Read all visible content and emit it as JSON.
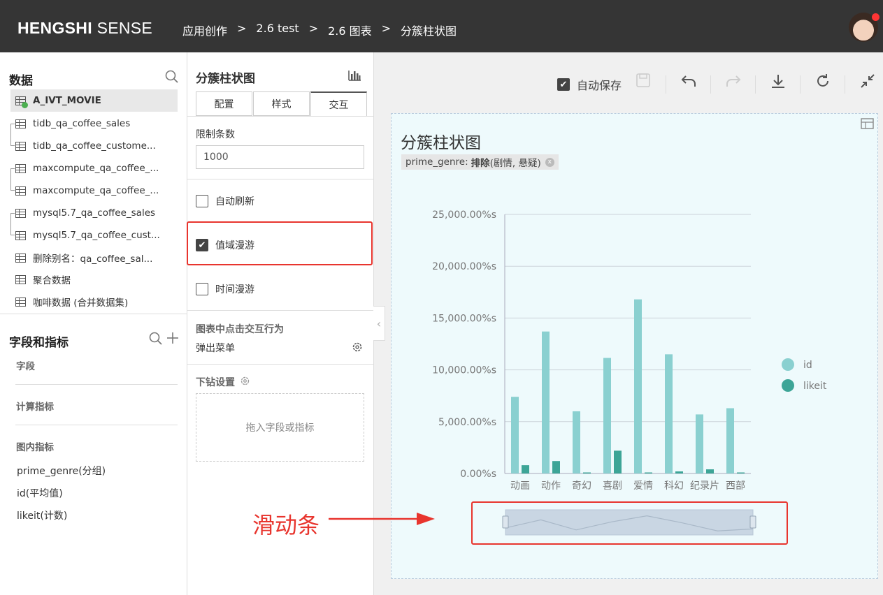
{
  "header": {
    "logo_bold": "HENGSHI",
    "logo_rest": " SENSE",
    "breadcrumbs": [
      "应用创作",
      "2.6 test",
      "2.6 图表",
      "分簇柱状图"
    ],
    "sep": ">"
  },
  "data_panel": {
    "title": "数据",
    "datasets": [
      {
        "label": "A_IVT_MOVIE",
        "active": true
      },
      {
        "label": "tidb_qa_coffee_sales"
      },
      {
        "label": "tidb_qa_coffee_custome..."
      },
      {
        "label": "maxcompute_qa_coffee_..."
      },
      {
        "label": "maxcompute_qa_coffee_..."
      },
      {
        "label": "mysql5.7_qa_coffee_sales"
      },
      {
        "label": "mysql5.7_qa_coffee_cust..."
      },
      {
        "label": "删除别名：qa_coffee_sal..."
      },
      {
        "label": "聚合数据"
      },
      {
        "label": "咖啡数据 (合并数据集)"
      }
    ]
  },
  "fields_panel": {
    "title": "字段和指标",
    "fields_head": "字段",
    "calc_head": "计算指标",
    "inchart_head": "图内指标",
    "inchart_items": [
      "prime_genre(分组)",
      "id(平均值)",
      "likeit(计数)"
    ]
  },
  "config_panel": {
    "title": "分簇柱状图",
    "tabs": [
      "配置",
      "样式",
      "交互"
    ],
    "active_tab": 2,
    "limit_label": "限制条数",
    "limit_value": "1000",
    "auto_refresh": "自动刷新",
    "range_roam": "值域漫游",
    "time_roam": "时间漫游",
    "click_action_label": "图表中点击交互行为",
    "click_action_value": "弹出菜单",
    "drill_label": "下钻设置",
    "drop_hint": "拖入字段或指标"
  },
  "toolbar": {
    "autosave": "自动保存"
  },
  "chart": {
    "title": "分簇柱状图",
    "filter_field": "prime_genre:",
    "filter_op": "排除",
    "filter_values": "(剧情, 悬疑)",
    "filter_close": "x"
  },
  "annotation": {
    "text": "滑动条",
    "color": "#e8352e"
  },
  "chart_data": {
    "type": "bar",
    "categories": [
      "动画",
      "动作",
      "奇幻",
      "喜剧",
      "爱情",
      "科幻",
      "纪录片",
      "西部"
    ],
    "series": [
      {
        "name": "id",
        "color": "#8ad0d0",
        "values": [
          7400,
          13700,
          6000,
          11150,
          16800,
          11500,
          5700,
          6300
        ]
      },
      {
        "name": "likeit",
        "color": "#3da597",
        "values": [
          800,
          1200,
          100,
          2200,
          100,
          200,
          400,
          100
        ]
      }
    ],
    "yticks": [
      "0.00%s",
      "5,000.00%s",
      "10,000.00%s",
      "15,000.00%s",
      "20,000.00%s",
      "25,000.00%s"
    ],
    "ylim": [
      0,
      25000
    ],
    "legend_position": "right",
    "grid": true,
    "slider_profile": [
      0.35,
      0.75,
      0.25,
      0.65,
      0.95,
      0.6,
      0.2,
      0.3
    ]
  }
}
